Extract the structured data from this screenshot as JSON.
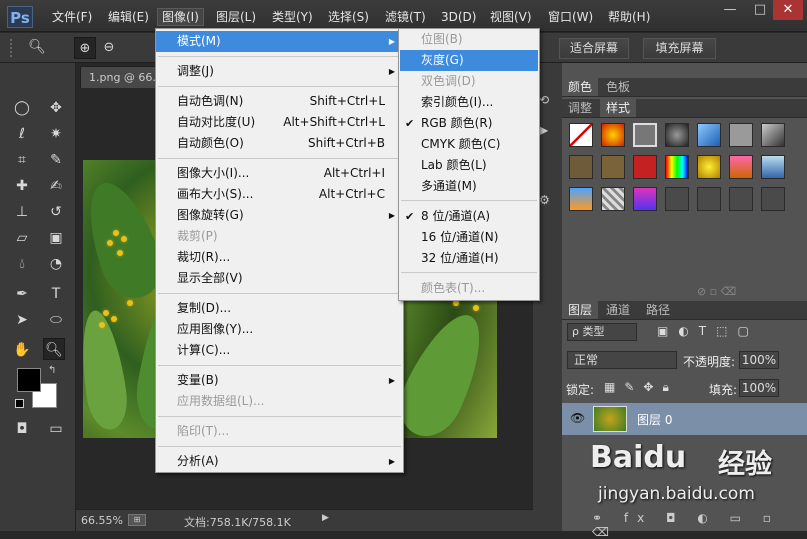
{
  "app": {
    "logo": "Ps"
  },
  "menubar": [
    {
      "label": "文件(F)",
      "active": false
    },
    {
      "label": "编辑(E)",
      "active": false
    },
    {
      "label": "图像(I)",
      "active": true
    },
    {
      "label": "图层(L)",
      "active": false
    },
    {
      "label": "类型(Y)",
      "active": false
    },
    {
      "label": "选择(S)",
      "active": false
    },
    {
      "label": "滤镜(T)",
      "active": false
    },
    {
      "label": "3D(D)",
      "active": false
    },
    {
      "label": "视图(V)",
      "active": false
    },
    {
      "label": "窗口(W)",
      "active": false
    },
    {
      "label": "帮助(H)",
      "active": false
    }
  ],
  "window_controls": {
    "minimize": "—",
    "restore": "□",
    "close": "✕"
  },
  "options_bar": {
    "fit_screen": "适合屏幕",
    "fill_screen": "填充屏幕"
  },
  "document": {
    "tab": "1.png @ 66.6",
    "zoom": "66.55%",
    "doc_info": "文档:758.1K/758.1K"
  },
  "image_menu": {
    "items": [
      {
        "label": "模式(M)",
        "shortcut": "",
        "submenu": true,
        "disabled": false,
        "highlighted": true,
        "sep_after": true
      },
      {
        "label": "调整(J)",
        "shortcut": "",
        "submenu": true,
        "disabled": false,
        "highlighted": false,
        "sep_after": true
      },
      {
        "label": "自动色调(N)",
        "shortcut": "Shift+Ctrl+L",
        "submenu": false,
        "disabled": false,
        "highlighted": false,
        "sep_after": false
      },
      {
        "label": "自动对比度(U)",
        "shortcut": "Alt+Shift+Ctrl+L",
        "submenu": false,
        "disabled": false,
        "highlighted": false,
        "sep_after": false
      },
      {
        "label": "自动颜色(O)",
        "shortcut": "Shift+Ctrl+B",
        "submenu": false,
        "disabled": false,
        "highlighted": false,
        "sep_after": true
      },
      {
        "label": "图像大小(I)...",
        "shortcut": "Alt+Ctrl+I",
        "submenu": false,
        "disabled": false,
        "highlighted": false,
        "sep_after": false
      },
      {
        "label": "画布大小(S)...",
        "shortcut": "Alt+Ctrl+C",
        "submenu": false,
        "disabled": false,
        "highlighted": false,
        "sep_after": false
      },
      {
        "label": "图像旋转(G)",
        "shortcut": "",
        "submenu": true,
        "disabled": false,
        "highlighted": false,
        "sep_after": false
      },
      {
        "label": "裁剪(P)",
        "shortcut": "",
        "submenu": false,
        "disabled": true,
        "highlighted": false,
        "sep_after": false
      },
      {
        "label": "裁切(R)...",
        "shortcut": "",
        "submenu": false,
        "disabled": false,
        "highlighted": false,
        "sep_after": false
      },
      {
        "label": "显示全部(V)",
        "shortcut": "",
        "submenu": false,
        "disabled": false,
        "highlighted": false,
        "sep_after": true
      },
      {
        "label": "复制(D)...",
        "shortcut": "",
        "submenu": false,
        "disabled": false,
        "highlighted": false,
        "sep_after": false
      },
      {
        "label": "应用图像(Y)...",
        "shortcut": "",
        "submenu": false,
        "disabled": false,
        "highlighted": false,
        "sep_after": false
      },
      {
        "label": "计算(C)...",
        "shortcut": "",
        "submenu": false,
        "disabled": false,
        "highlighted": false,
        "sep_after": true
      },
      {
        "label": "变量(B)",
        "shortcut": "",
        "submenu": true,
        "disabled": false,
        "highlighted": false,
        "sep_after": false
      },
      {
        "label": "应用数据组(L)...",
        "shortcut": "",
        "submenu": false,
        "disabled": true,
        "highlighted": false,
        "sep_after": true
      },
      {
        "label": "陷印(T)...",
        "shortcut": "",
        "submenu": false,
        "disabled": true,
        "highlighted": false,
        "sep_after": true
      },
      {
        "label": "分析(A)",
        "shortcut": "",
        "submenu": true,
        "disabled": false,
        "highlighted": false,
        "sep_after": false
      }
    ]
  },
  "mode_submenu": {
    "items": [
      {
        "label": "位图(B)",
        "disabled": true,
        "highlighted": false,
        "checked": false,
        "sep_after": false
      },
      {
        "label": "灰度(G)",
        "disabled": false,
        "highlighted": true,
        "checked": false,
        "sep_after": false
      },
      {
        "label": "双色调(D)",
        "disabled": true,
        "highlighted": false,
        "checked": false,
        "sep_after": false
      },
      {
        "label": "索引颜色(I)...",
        "disabled": false,
        "highlighted": false,
        "checked": false,
        "sep_after": false
      },
      {
        "label": "RGB 颜色(R)",
        "disabled": false,
        "highlighted": false,
        "checked": true,
        "sep_after": false
      },
      {
        "label": "CMYK 颜色(C)",
        "disabled": false,
        "highlighted": false,
        "checked": false,
        "sep_after": false
      },
      {
        "label": "Lab 颜色(L)",
        "disabled": false,
        "highlighted": false,
        "checked": false,
        "sep_after": false
      },
      {
        "label": "多通道(M)",
        "disabled": false,
        "highlighted": false,
        "checked": false,
        "sep_after": true
      },
      {
        "label": "8 位/通道(A)",
        "disabled": false,
        "highlighted": false,
        "checked": true,
        "sep_after": false
      },
      {
        "label": "16 位/通道(N)",
        "disabled": false,
        "highlighted": false,
        "checked": false,
        "sep_after": false
      },
      {
        "label": "32 位/通道(H)",
        "disabled": false,
        "highlighted": false,
        "checked": false,
        "sep_after": true
      },
      {
        "label": "颜色表(T)...",
        "disabled": true,
        "highlighted": false,
        "checked": false,
        "sep_after": false
      }
    ]
  },
  "color_panel": {
    "tabs": [
      "颜色",
      "色板"
    ]
  },
  "styles_panel": {
    "tabs": [
      "调整",
      "样式"
    ]
  },
  "layers_panel": {
    "tabs": [
      "图层",
      "通道",
      "路径"
    ],
    "kind_filter": "ρ 类型",
    "blend_mode": "正常",
    "opacity_label": "不透明度:",
    "opacity_value": "100%",
    "lock_label": "锁定:",
    "fill_label": "填充:",
    "fill_value": "100%",
    "layer_name": "图层 0"
  },
  "watermark": {
    "brand": "Baidu",
    "cn": "经验",
    "url": "jingyan.baidu.com"
  },
  "colors": {
    "accent": "#3e8bde",
    "ui_bg": "#3a3a3a",
    "panel_bg": "#535353"
  }
}
